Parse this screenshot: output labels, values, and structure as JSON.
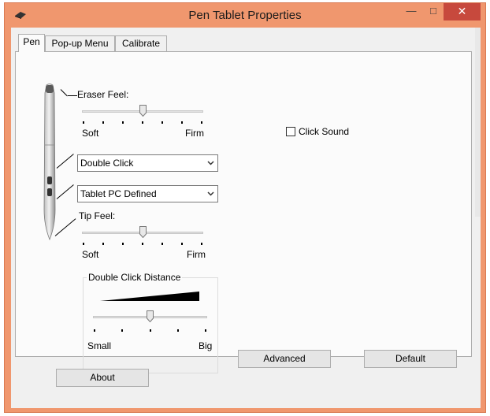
{
  "window": {
    "title": "Pen Tablet Properties",
    "min_glyph": "—",
    "max_glyph": "□",
    "close_glyph": "✕"
  },
  "tabs": [
    {
      "label": "Pen",
      "active": true
    },
    {
      "label": "Pop-up Menu",
      "active": false
    },
    {
      "label": "Calibrate",
      "active": false
    }
  ],
  "eraser": {
    "label": "Eraser Feel:",
    "min_label": "Soft",
    "max_label": "Firm",
    "value_fraction": 0.5
  },
  "side_button_upper": {
    "value": "Double Click"
  },
  "side_button_lower": {
    "value": "Tablet PC Defined"
  },
  "tip": {
    "label": "Tip Feel:",
    "min_label": "Soft",
    "max_label": "Firm",
    "value_fraction": 0.5
  },
  "click_sound": {
    "label": "Click Sound",
    "checked": false
  },
  "double_click_distance": {
    "title": "Double Click Distance",
    "min_label": "Small",
    "max_label": "Big",
    "value_fraction": 0.5
  },
  "buttons": {
    "advanced": "Advanced",
    "default": "Default",
    "about": "About"
  },
  "colors": {
    "frame": "#f0976e",
    "close": "#c7493d"
  }
}
